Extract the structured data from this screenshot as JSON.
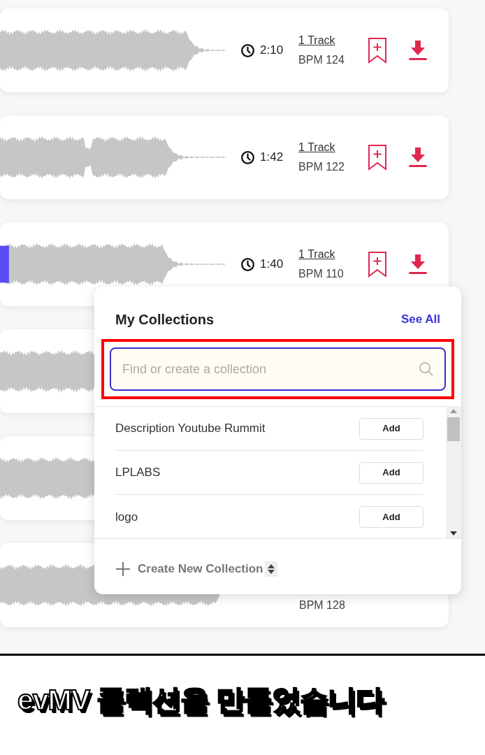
{
  "tracks": [
    {
      "kind": "full",
      "duration": "2:10",
      "tracks_link": "1 Track",
      "bpm": "BPM 124"
    },
    {
      "kind": "full",
      "duration": "1:42",
      "tracks_link": "1 Track",
      "bpm": "BPM 122"
    },
    {
      "kind": "full",
      "duration": "1:40",
      "tracks_link": "1 Track",
      "bpm": "BPM 110",
      "level": 0.04
    },
    {
      "kind": "covered"
    },
    {
      "kind": "covered"
    },
    {
      "kind": "covered",
      "bpm": "BPM 128"
    }
  ],
  "collections_popup": {
    "title": "My Collections",
    "see_all": "See All",
    "search": {
      "placeholder": "Find or create a collection",
      "highlighted": true
    },
    "items": [
      {
        "name": "Description Youtube Rummit",
        "action": "Add"
      },
      {
        "name": "LPLABS",
        "action": "Add"
      },
      {
        "name": "logo",
        "action": "Add"
      }
    ],
    "create_new": "Create New Collection"
  },
  "caption": "evMV 콜렉션을 만들었습니다"
}
